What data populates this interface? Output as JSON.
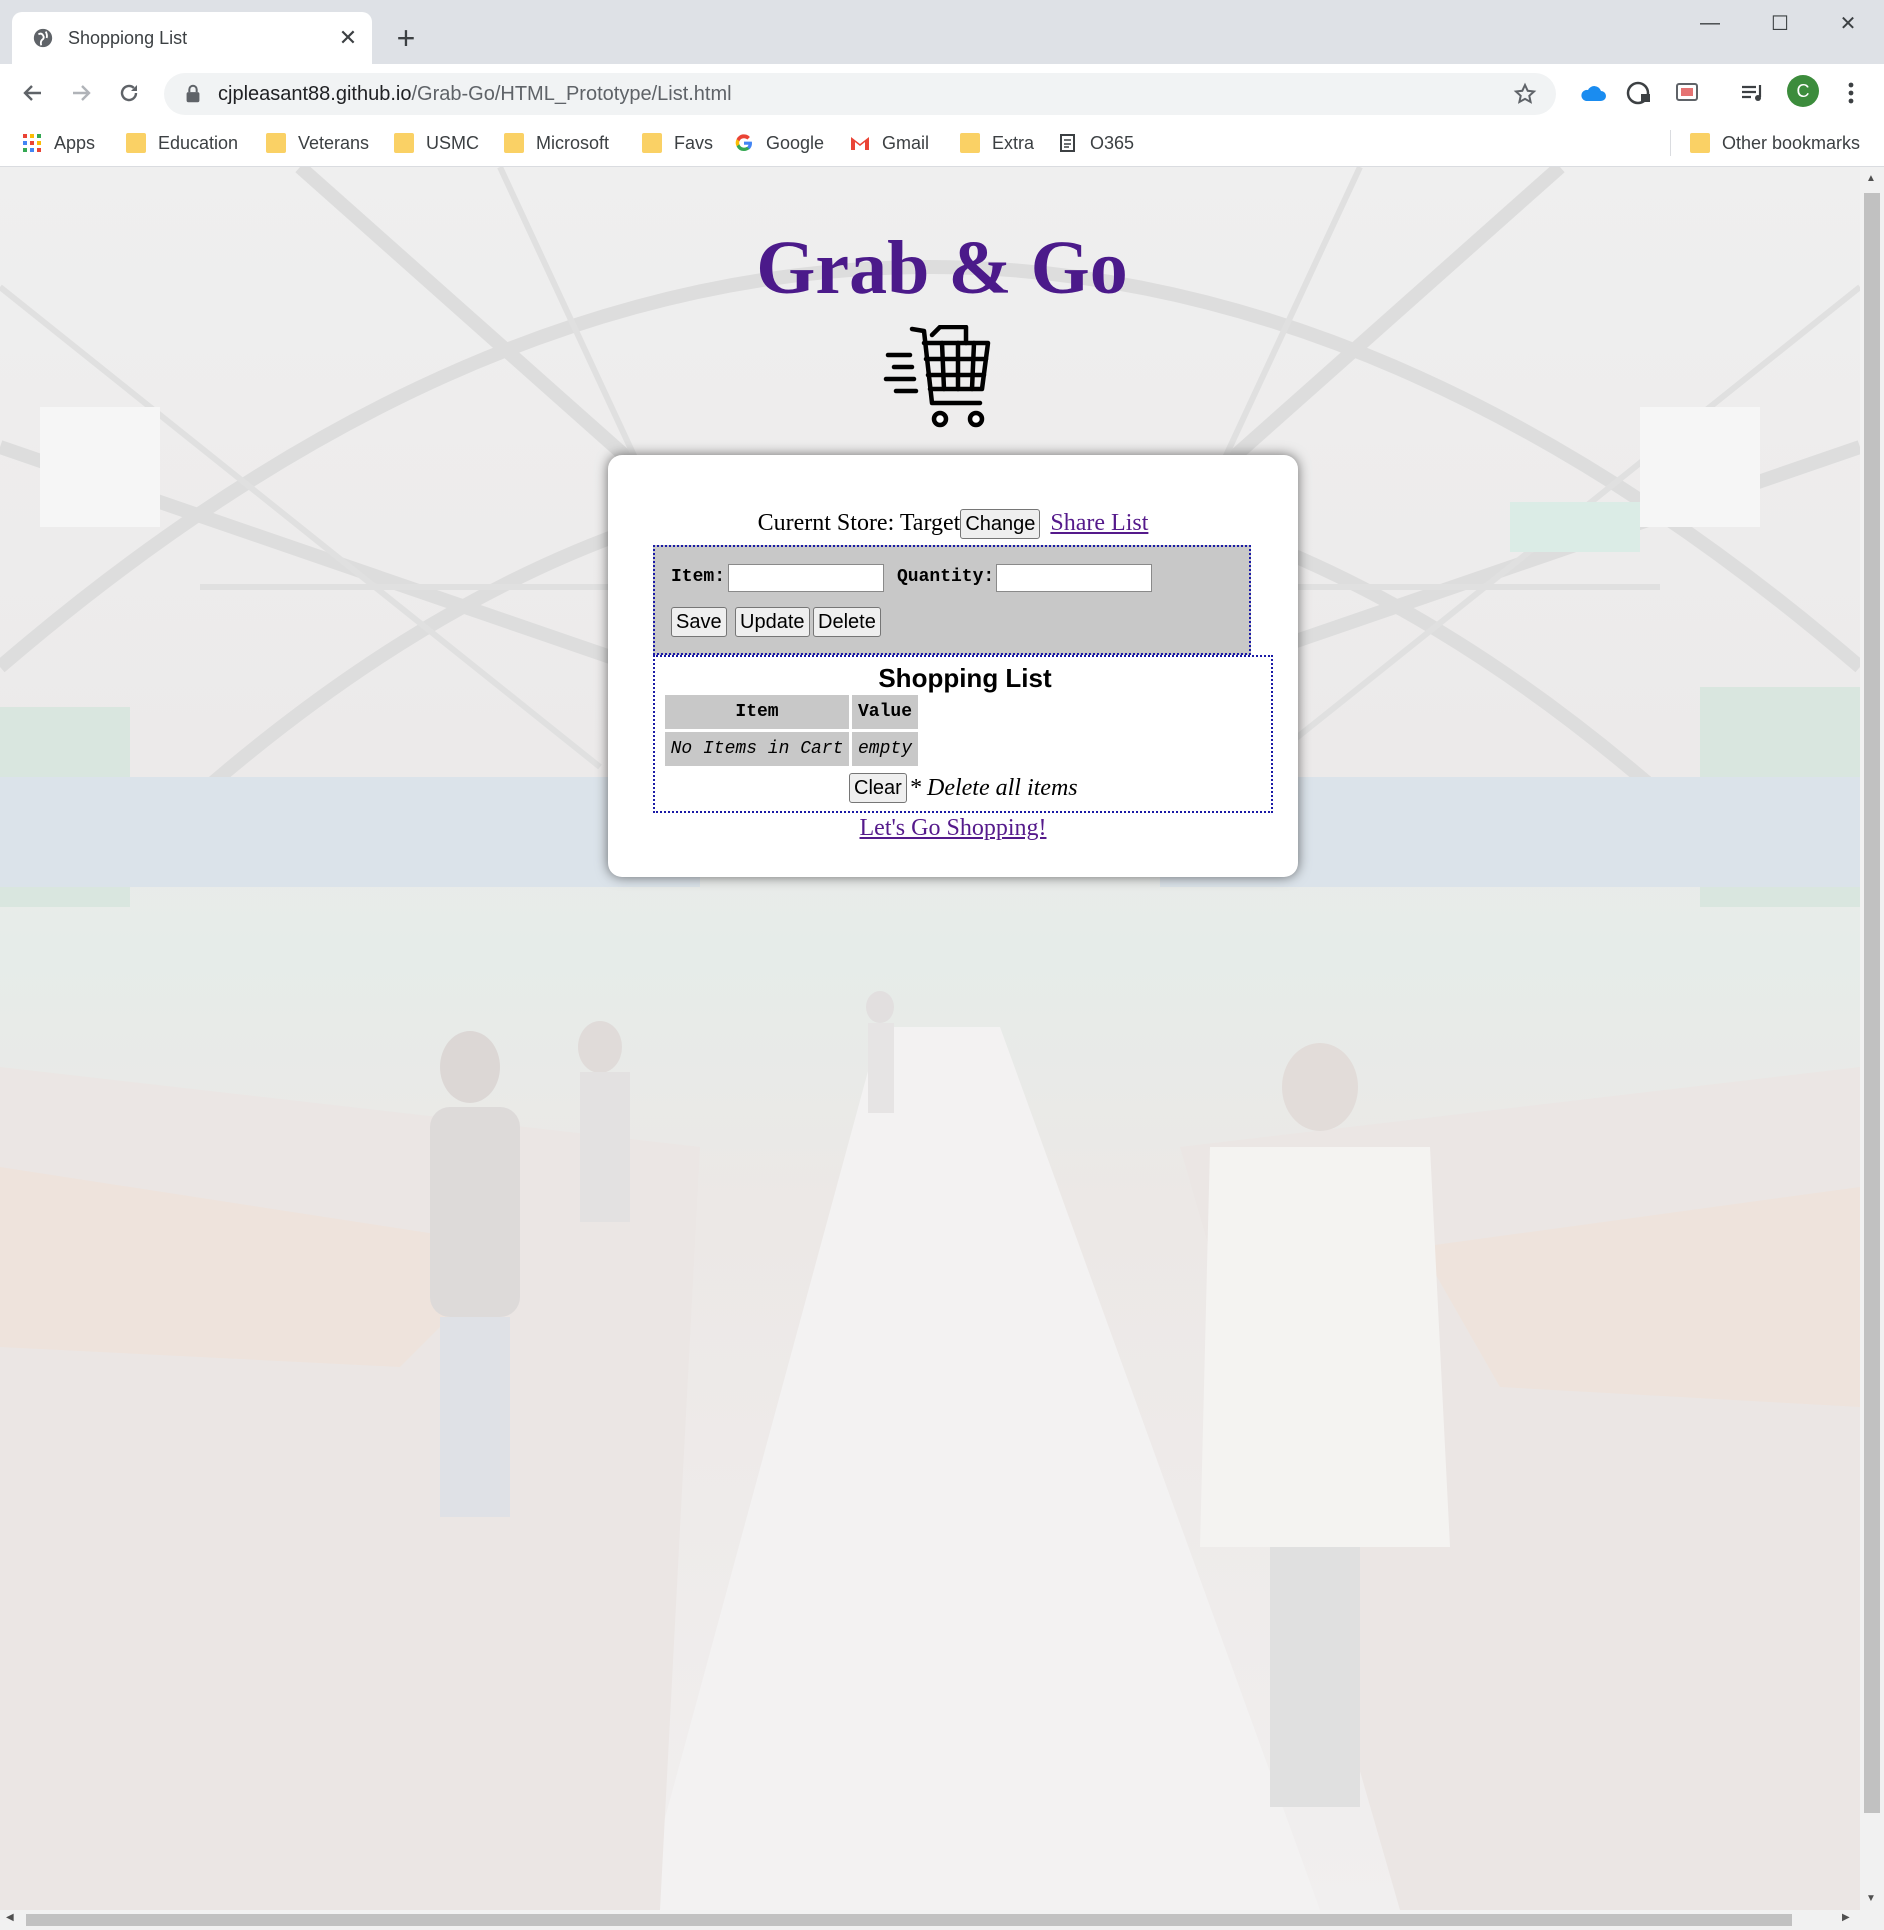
{
  "browser": {
    "tab_title": "Shoppiong List",
    "new_tab": "+",
    "url_host": "cjpleasant88.github.io",
    "url_path": "/Grab-Go/HTML_Prototype/List.html",
    "profile_initial": "C",
    "bookmarks": [
      "Apps",
      "Education",
      "Veterans",
      "USMC",
      "Microsoft",
      "Favs",
      "Google",
      "Gmail",
      "Extra",
      "O365"
    ],
    "other_bookmarks": "Other bookmarks"
  },
  "page": {
    "title": "Grab & Go",
    "store_label": "Curernt Store: Target",
    "change_button": "Change",
    "share_link": "Share List",
    "form": {
      "item_label": "Item:",
      "item_value": "",
      "quantity_label": "Quantity:",
      "quantity_value": "",
      "save_button": "Save",
      "update_button": "Update",
      "delete_button": "Delete"
    },
    "list": {
      "title": "Shopping List",
      "columns": [
        "Item",
        "Value"
      ],
      "rows": [
        [
          "No Items in Cart",
          "empty"
        ]
      ],
      "clear_button": "Clear",
      "clear_note": "* Delete all items"
    },
    "shop_link": "Let's Go Shopping!"
  },
  "colors": {
    "title": "#4b1a8a",
    "link": "#551a8b",
    "form_bg": "#c8c8c8",
    "dotted_border": "#1a1aa6"
  }
}
